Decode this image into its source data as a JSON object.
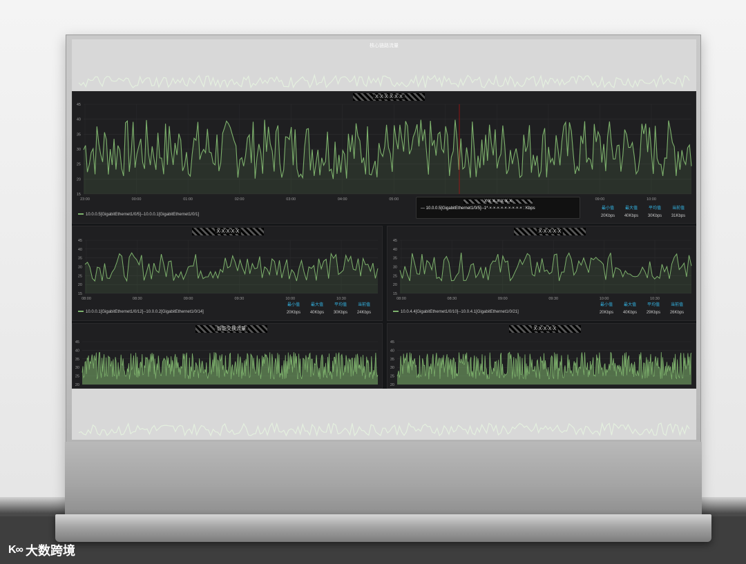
{
  "dashboard_title": "核心链路流量",
  "brand": {
    "mark": "K∞",
    "name": "大数跨境"
  },
  "panels": {
    "main": {
      "title": "X·X·X·X·X·X",
      "legend": "10.0.0.5[GigabitEthernet1/0/5]--10.0.0.1[GigabitEthernet1/0/1]",
      "stats_headers": [
        "最小值",
        "最大值",
        "平均值",
        "当前值"
      ],
      "stats_values": [
        "20Kbps",
        "40Kbps",
        "30Kbps",
        "31Kbps"
      ],
      "tooltip_title": "X·X·X·X·X·X·X",
      "tooltip_text": "— 10.0.0.5[GigabitEthernet1/0/5]--1*·×·×·×·×·×·×·×·×·× : Kbps"
    },
    "mid_left": {
      "title": "X·X·X·X·X",
      "legend": "10.0.0.1[GigabitEthernet1/0/12]--10.0.0.2[GigabitEthernet1/0/14]",
      "stats_headers": [
        "最小值",
        "最大值",
        "平均值",
        "当前值"
      ],
      "stats_values": [
        "20Kbps",
        "40Kbps",
        "30Kbps",
        "24Kbps"
      ]
    },
    "mid_right": {
      "title": "X·X·X·X·X",
      "legend": "10.0.4.4[GigabitEthernet1/0/10]--10.0.4.1[GigabitEthernet1/0/21]",
      "stats_headers": [
        "最小值",
        "最大值",
        "平均值",
        "当前值"
      ],
      "stats_values": [
        "20Kbps",
        "40Kbps",
        "29Kbps",
        "26Kbps"
      ]
    },
    "bot_left": {
      "title": "智能交换流量"
    },
    "bot_right": {
      "title": "X·X·X·X·X"
    }
  },
  "chart_data": [
    {
      "type": "line",
      "name": "main",
      "x": [
        "23:00",
        "00:00",
        "01:00",
        "02:00",
        "03:00",
        "04:00",
        "05:00",
        "06:00",
        "07:00",
        "08:00",
        "09:00",
        "10:00"
      ],
      "ylim": [
        15,
        45
      ],
      "yticks": [
        15,
        20,
        25,
        30,
        35,
        40,
        45
      ],
      "color": "#7eb26d"
    },
    {
      "type": "line",
      "name": "mid_left",
      "x": [
        "08:00",
        "08:30",
        "09:00",
        "09:30",
        "10:00",
        "10:30"
      ],
      "ylim": [
        15,
        45
      ],
      "yticks": [
        15,
        20,
        25,
        30,
        35,
        40,
        45
      ],
      "color": "#7eb26d"
    },
    {
      "type": "line",
      "name": "mid_right",
      "x": [
        "08:00",
        "08:30",
        "09:00",
        "09:30",
        "10:00",
        "10:30"
      ],
      "ylim": [
        15,
        45
      ],
      "yticks": [
        15,
        20,
        25,
        30,
        35,
        40,
        45
      ],
      "color": "#7eb26d"
    },
    {
      "type": "area",
      "name": "bot_left",
      "ylim": [
        20,
        45
      ],
      "yticks": [
        20,
        25,
        30,
        35,
        40,
        45
      ],
      "color": "#7eb26d"
    },
    {
      "type": "area",
      "name": "bot_right",
      "ylim": [
        20,
        45
      ],
      "yticks": [
        20,
        25,
        30,
        35,
        40,
        45
      ],
      "color": "#7eb26d"
    }
  ]
}
